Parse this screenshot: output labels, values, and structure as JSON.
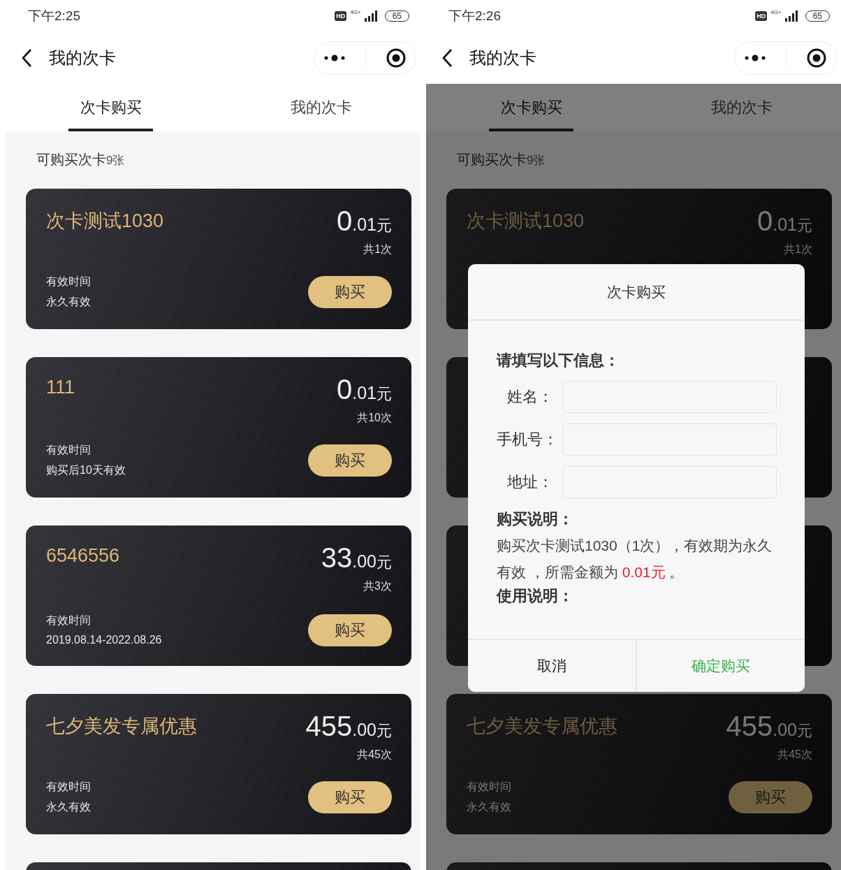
{
  "screens": [
    {
      "status_bar": {
        "time": "下午2:25",
        "hd": "HD",
        "network": "4G+",
        "battery": "65"
      },
      "nav": {
        "title": "我的次卡"
      },
      "tabs": [
        {
          "label": "次卡购买",
          "selected": true
        },
        {
          "label": "我的次卡",
          "selected": false
        }
      ],
      "summary": {
        "label": "可购买次卡",
        "count": "9张"
      },
      "cards": [
        {
          "kind": "full",
          "title": "次卡测试1030",
          "price_int": "0",
          "price_dec": ".01",
          "unit": "元",
          "uses": "共1次",
          "valid_label": "有效时间",
          "valid_value": "永久有效",
          "button": "购买"
        },
        {
          "kind": "full",
          "title": "111",
          "price_int": "0",
          "price_dec": ".01",
          "unit": "元",
          "uses": "共10次",
          "valid_label": "有效时间",
          "valid_value": "购买后10天有效",
          "button": "购买"
        },
        {
          "kind": "full",
          "title": "6546556",
          "price_int": "33",
          "price_dec": ".00",
          "unit": "元",
          "uses": "共3次",
          "valid_label": "有效时间",
          "valid_value": "2019.08.14-2022.08.26",
          "button": "购买"
        },
        {
          "kind": "full",
          "title": "七夕美发专属优惠",
          "price_int": "455",
          "price_dec": ".00",
          "unit": "元",
          "uses": "共45次",
          "valid_label": "有效时间",
          "valid_value": "永久有效",
          "button": "购买"
        },
        {
          "kind": "blank"
        }
      ]
    },
    {
      "status_bar": {
        "time": "下午2:26",
        "hd": "HD",
        "network": "4G+",
        "battery": "65"
      },
      "nav": {
        "title": "我的次卡"
      },
      "tabs": [
        {
          "label": "次卡购买",
          "selected": true
        },
        {
          "label": "我的次卡",
          "selected": false
        }
      ],
      "summary": {
        "label": "可购买次卡",
        "count": "9张"
      },
      "cards": [
        {
          "kind": "top",
          "title": "次卡测试1030",
          "price_int": "0",
          "price_dec": ".01",
          "unit": "元",
          "uses": "共1次"
        },
        {
          "kind": "blank"
        },
        {
          "kind": "blank"
        },
        {
          "kind": "full",
          "title": "七夕美发专属优惠",
          "price_int": "455",
          "price_dec": ".00",
          "unit": "元",
          "uses": "共45次",
          "valid_label": "有效时间",
          "valid_value": "永久有效",
          "button": "购买"
        },
        {
          "kind": "blank"
        }
      ],
      "dialog": {
        "title": "次卡购买",
        "form_heading": "请填写以下信息：",
        "fields": [
          {
            "label": "姓名："
          },
          {
            "label": "手机号："
          },
          {
            "label": "地址："
          }
        ],
        "purchase_heading": "购买说明：",
        "purchase_note": {
          "before": "购买次卡测试1030（1次），有效期为永久有效 ，所需金额为 ",
          "amount": "0.01元",
          "after": " 。"
        },
        "usage_heading": "使用说明：",
        "buttons": [
          {
            "label": "取消",
            "kind": "cancel"
          },
          {
            "label": "确定购买",
            "kind": "confirm"
          }
        ]
      }
    }
  ]
}
